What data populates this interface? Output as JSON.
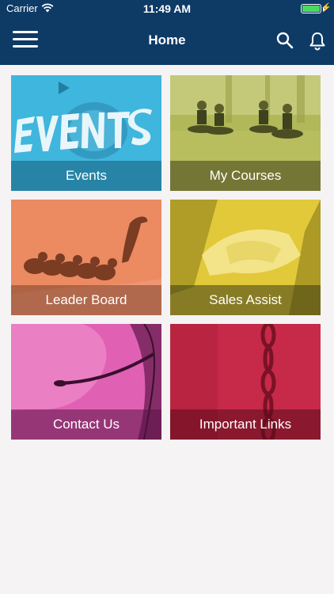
{
  "status_bar": {
    "carrier": "Carrier",
    "time": "11:49 AM",
    "battery_level": 1.0
  },
  "nav": {
    "title": "Home",
    "menu_icon": "hamburger-icon",
    "search_icon": "search-icon",
    "notifications_icon": "bell-icon"
  },
  "tiles": [
    {
      "label": "Events",
      "color": "#3fb6dd"
    },
    {
      "label": "My Courses",
      "color": "#a8b04e"
    },
    {
      "label": "Leader Board",
      "color": "#ec8a62"
    },
    {
      "label": "Sales Assist",
      "color": "#d8c032"
    },
    {
      "label": "Contact Us",
      "color": "#e061b3"
    },
    {
      "label": "Important Links",
      "color": "#c62a48"
    }
  ],
  "colors": {
    "header": "#0e3a66",
    "background": "#f5f3f4"
  }
}
